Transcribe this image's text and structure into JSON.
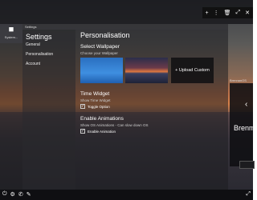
{
  "topbar": {
    "controls": [
      "+",
      "⋮",
      "🗑",
      "⤢",
      "✕"
    ]
  },
  "dock": {
    "app_label": "System..."
  },
  "window": {
    "title": "Settings"
  },
  "sidebar": {
    "title": "Settings",
    "items": [
      {
        "label": "General"
      },
      {
        "label": "Personalisation"
      },
      {
        "label": "Account"
      }
    ]
  },
  "main": {
    "title": "Personalisation",
    "wallpaper": {
      "heading": "Select Wallpaper",
      "subtext": "Choose your Wallpaper",
      "upload_label": "+ Upload Custom"
    },
    "time_widget": {
      "heading": "Time Widget",
      "subtext": "Show Time Widget",
      "toggle_label": "Toggle Option",
      "checked": true
    },
    "animations": {
      "heading": "Enable Animations",
      "subtext": "Show OS Animations - Can slow down OS",
      "toggle_label": "Enable Animation",
      "checked": true
    }
  },
  "side_panel": {
    "small_title": "BrennanOS",
    "brand": "Brenm"
  },
  "taskbar": {
    "icons": [
      "⏻",
      "⚙",
      "✆",
      "✎"
    ]
  }
}
